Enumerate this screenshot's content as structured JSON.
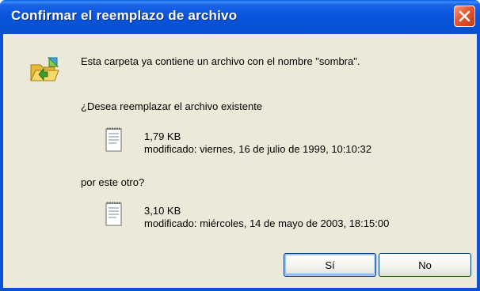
{
  "dialog": {
    "title": "Confirmar el reemplazo de archivo",
    "message": "Esta carpeta ya contiene un archivo con el nombre \"sombra\".",
    "question": "¿Desea reemplazar el archivo existente",
    "existing_file": {
      "size": "1,79 KB",
      "modified": "modificado: viernes, 16 de julio de 1999, 10:10:32"
    },
    "connector": "por este otro?",
    "new_file": {
      "size": "3,10 KB",
      "modified": "modificado: miércoles, 14 de mayo de 2003, 18:15:00"
    },
    "buttons": {
      "yes": "Sí",
      "no": "No"
    }
  },
  "icons": {
    "close": "close-icon",
    "folder": "folder-replace-icon",
    "file": "text-file-icon"
  },
  "colors": {
    "titlebar": "#0a55dc",
    "close_button": "#e4562f",
    "client_background": "#ece9d8"
  }
}
